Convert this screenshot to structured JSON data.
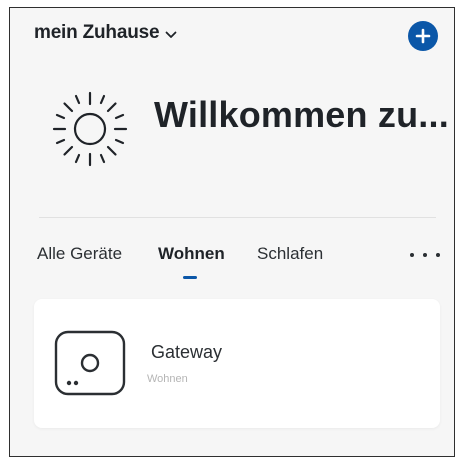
{
  "header": {
    "home_name": "mein Zuhause",
    "home_dropdown_icon": "chevron-down-icon",
    "add_icon": "plus-icon"
  },
  "welcome": {
    "weather_icon": "sun-icon",
    "title": "Willkommen zu..."
  },
  "tabs": {
    "items": [
      {
        "label": "Alle Geräte",
        "active": false
      },
      {
        "label": "Wohnen",
        "active": true
      },
      {
        "label": "Schlafen",
        "active": false
      }
    ],
    "more_icon": "more-horizontal-icon"
  },
  "devices": [
    {
      "name": "Gateway",
      "room": "Wohnen",
      "icon": "gateway-icon"
    }
  ],
  "colors": {
    "accent": "#0b57a8",
    "background": "#f6f6f6",
    "card": "#ffffff",
    "text": "#1f2328",
    "muted": "#b5b5b5"
  }
}
